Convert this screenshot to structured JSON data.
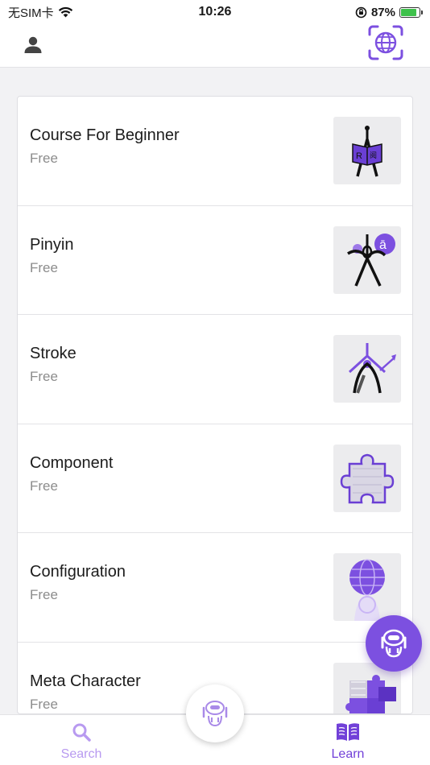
{
  "status_bar": {
    "carrier": "无SIM卡",
    "time": "10:26",
    "battery": "87%",
    "battery_level": 0.87
  },
  "colors": {
    "accent": "#7c50e0",
    "accent_light": "#b89af0",
    "battery_green": "#3ec14b"
  },
  "header": {
    "user_icon": "person-icon",
    "scan_icon": "globe-scan-icon"
  },
  "courses": [
    {
      "title": "Course For Beginner",
      "price": "Free",
      "icon": "figure-book-icon"
    },
    {
      "title": "Pinyin",
      "price": "Free",
      "icon": "figure-pinyin-icon",
      "badge": "ā"
    },
    {
      "title": "Stroke",
      "price": "Free",
      "icon": "figure-brush-icon"
    },
    {
      "title": "Component",
      "price": "Free",
      "icon": "puzzle-piece-icon"
    },
    {
      "title": "Configuration",
      "price": "Free",
      "icon": "globe-figure-icon"
    },
    {
      "title": "Meta Character",
      "price": "Free",
      "icon": "puzzle-pieces-icon"
    }
  ],
  "tabs": {
    "search": {
      "label": "Search",
      "icon": "search-icon"
    },
    "learn": {
      "label": "Learn",
      "icon": "book-icon"
    },
    "center": {
      "icon": "robot-icon"
    }
  },
  "fab": {
    "icon": "robot-icon"
  }
}
